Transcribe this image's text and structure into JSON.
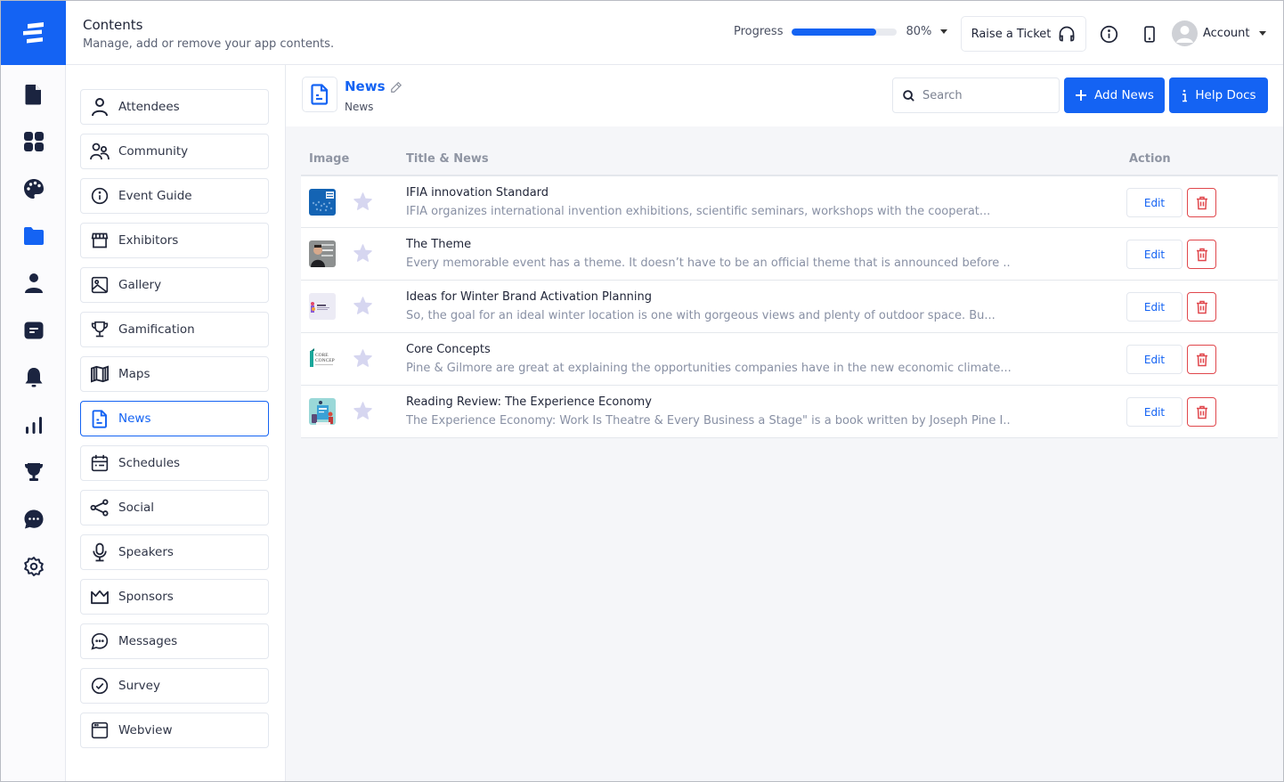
{
  "header": {
    "title": "Contents",
    "subtitle": "Manage, add or remove your app contents.",
    "progress_label": "Progress",
    "progress_value": 80,
    "progress_text": "80%",
    "raise_ticket_label": "Raise a Ticket",
    "account_label": "Account"
  },
  "colors": {
    "brand": "#1463f3",
    "danger": "#e0474c",
    "star": "#d6d6f0"
  },
  "rail": {
    "items": [
      {
        "name": "document-icon",
        "active": false
      },
      {
        "name": "grid-icon",
        "active": false
      },
      {
        "name": "palette-icon",
        "active": false
      },
      {
        "name": "folder-icon",
        "active": true
      },
      {
        "name": "user-icon",
        "active": false
      },
      {
        "name": "message-square-icon",
        "active": false
      },
      {
        "name": "bell-icon",
        "active": false
      },
      {
        "name": "bar-chart-icon",
        "active": false
      },
      {
        "name": "trophy-icon",
        "active": false
      },
      {
        "name": "chat-bubble-icon",
        "active": false
      },
      {
        "name": "gear-icon",
        "active": false
      }
    ]
  },
  "content_list": {
    "items": [
      {
        "label": "Attendees",
        "icon": "person-icon",
        "active": false
      },
      {
        "label": "Community",
        "icon": "users-icon",
        "active": false
      },
      {
        "label": "Event Guide",
        "icon": "info-icon",
        "active": false
      },
      {
        "label": "Exhibitors",
        "icon": "storefront-icon",
        "active": false
      },
      {
        "label": "Gallery",
        "icon": "image-icon",
        "active": false
      },
      {
        "label": "Gamification",
        "icon": "trophy-icon",
        "active": false
      },
      {
        "label": "Maps",
        "icon": "map-icon",
        "active": false
      },
      {
        "label": "News",
        "icon": "news-document-icon",
        "active": true
      },
      {
        "label": "Schedules",
        "icon": "calendar-icon",
        "active": false
      },
      {
        "label": "Social",
        "icon": "share-icon",
        "active": false
      },
      {
        "label": "Speakers",
        "icon": "microphone-icon",
        "active": false
      },
      {
        "label": "Sponsors",
        "icon": "crown-icon",
        "active": false
      },
      {
        "label": "Messages",
        "icon": "chat-icon",
        "active": false
      },
      {
        "label": "Survey",
        "icon": "check-circle-icon",
        "active": false
      },
      {
        "label": "Webview",
        "icon": "browser-window-icon",
        "active": false
      }
    ]
  },
  "main": {
    "title": "News",
    "subtitle": "News",
    "search_placeholder": "Search",
    "search_value": "",
    "add_button_label": "Add News",
    "help_button_label": "Help Docs",
    "table": {
      "columns": [
        "Image",
        "Title & News",
        "Action"
      ],
      "edit_label": "Edit",
      "rows": [
        {
          "title": "IFIA innovation Standard",
          "description": "IFIA organizes international invention exhibitions, scientific seminars, workshops with the cooperat...",
          "thumb": "ifia"
        },
        {
          "title": "The Theme",
          "description": "Every memorable event has a theme. It doesn’t have to be an official theme that is announced before ...",
          "thumb": "theme"
        },
        {
          "title": "Ideas for Winter Brand Activation Planning",
          "description": "So, the goal for an ideal winter location is one with gorgeous views and plenty of outdoor space. Bu...",
          "thumb": "winter"
        },
        {
          "title": "Core Concepts",
          "description": "Pine & Gilmore are great at explaining the opportunities companies have in the new economic climate....",
          "thumb": "core"
        },
        {
          "title": "Reading Review: The Experience Economy",
          "description": "The Experience Economy: Work Is Theatre & Every Business a Stage\" is a book written by Joseph Pine I...",
          "thumb": "reading"
        }
      ]
    }
  }
}
